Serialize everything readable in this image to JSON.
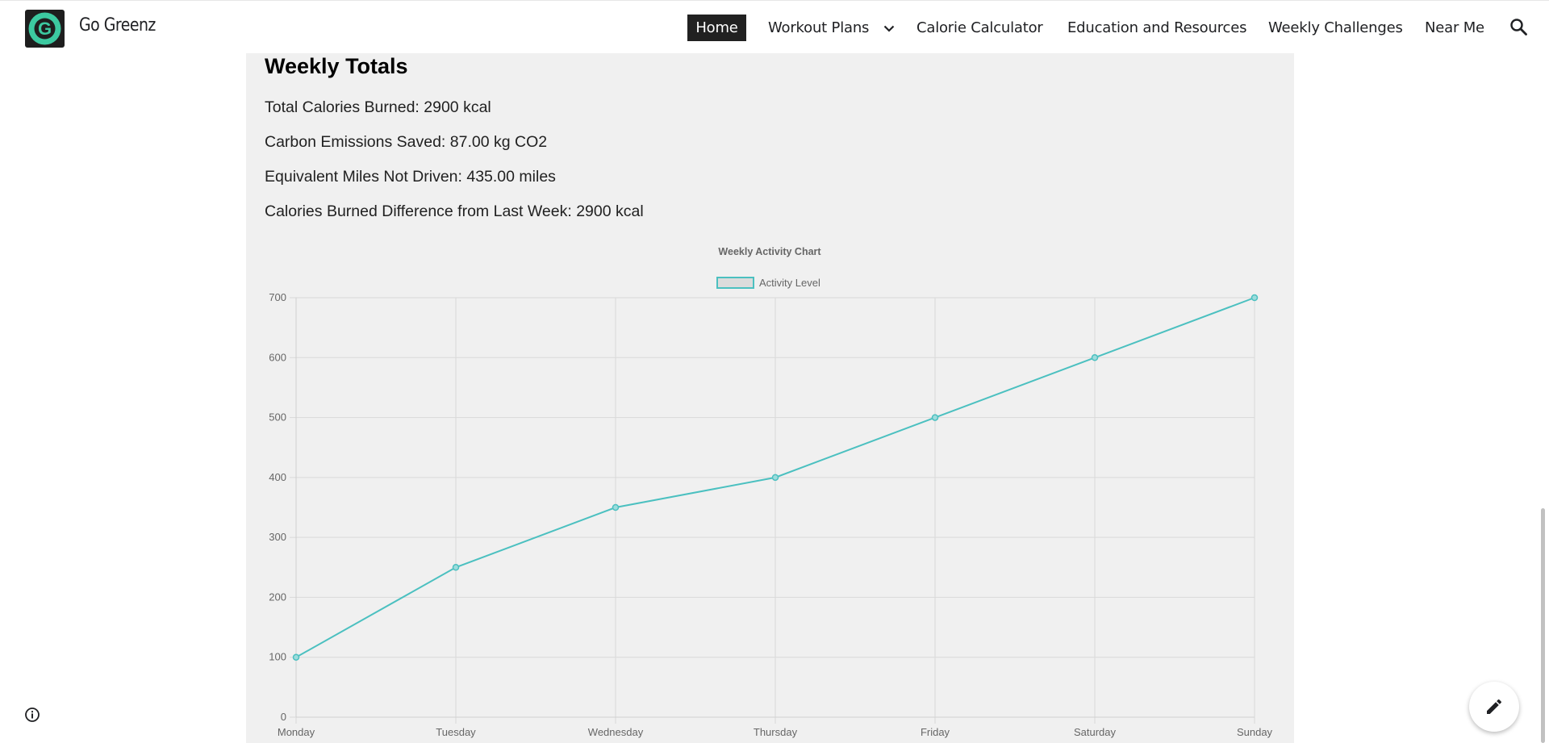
{
  "header": {
    "logo_letter": "G",
    "site_title": "Go Greenz",
    "nav": {
      "home": "Home",
      "workout_plans": "Workout Plans",
      "calorie_calculator": "Calorie Calculator",
      "education": "Education and Resources",
      "weekly_challenges": "Weekly Challenges",
      "near_me": "Near Me"
    }
  },
  "weekly_totals": {
    "title": "Weekly Totals",
    "calories": "Total Calories Burned: 2900 kcal",
    "carbon": "Carbon Emissions Saved: 87.00 kg CO2",
    "miles": "Equivalent Miles Not Driven: 435.00 miles",
    "difference": "Calories Burned Difference from Last Week: 2900 kcal"
  },
  "colors": {
    "accent": "#4bc0c0",
    "panel_bg": "#f0f0f0",
    "logo_green": "#3cc9a0"
  },
  "icons": {
    "dropdown": "chevron-down-icon",
    "search": "search-icon",
    "info": "info-icon",
    "edit": "pencil-icon"
  },
  "chart_data": {
    "type": "line",
    "title": "Weekly Activity Chart",
    "categories": [
      "Monday",
      "Tuesday",
      "Wednesday",
      "Thursday",
      "Friday",
      "Saturday",
      "Sunday"
    ],
    "series": [
      {
        "name": "Activity Level",
        "values": [
          100,
          250,
          350,
          400,
          500,
          600,
          700
        ],
        "color": "#4bc0c0"
      }
    ],
    "yticks": [
      0,
      100,
      200,
      300,
      400,
      500,
      600,
      700
    ],
    "ylim": [
      0,
      700
    ],
    "grid": true,
    "legend": "top-center",
    "xlabel": "",
    "ylabel": ""
  }
}
